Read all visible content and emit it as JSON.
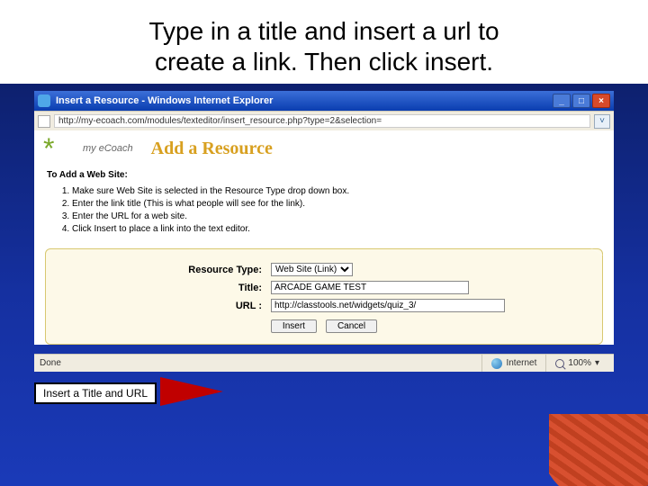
{
  "slide": {
    "title_line1": "Type in a title and insert a url to",
    "title_line2": "create a link. Then click insert."
  },
  "window": {
    "title": "Insert a Resource - Windows Internet Explorer",
    "address": "http://my-ecoach.com/modules/texteditor/insert_resource.php?type=2&selection=",
    "min": "_",
    "max": "□",
    "close": "×",
    "go": "˅"
  },
  "page": {
    "logo_text": "my eCoach",
    "heading": "Add a Resource",
    "subhead": "To Add a Web Site:",
    "steps": [
      "Make sure Web Site is selected in the Resource Type drop down box.",
      "Enter the link title (This is what people will see for the link).",
      "Enter the URL for a web site.",
      "Click Insert to place a link into the text editor."
    ]
  },
  "form": {
    "resource_type_label": "Resource Type:",
    "resource_type_value": "Web Site (Link)",
    "title_label": "Title:",
    "title_value": "ARCADE GAME TEST",
    "url_label": "URL :",
    "url_value": "http://classtools.net/widgets/quiz_3/",
    "insert_btn": "Insert",
    "cancel_btn": "Cancel"
  },
  "status": {
    "done": "Done",
    "zone": "Internet",
    "zoom": "100%",
    "zoom_caret": "▾"
  },
  "callout": {
    "text": "Insert a Title and URL"
  }
}
